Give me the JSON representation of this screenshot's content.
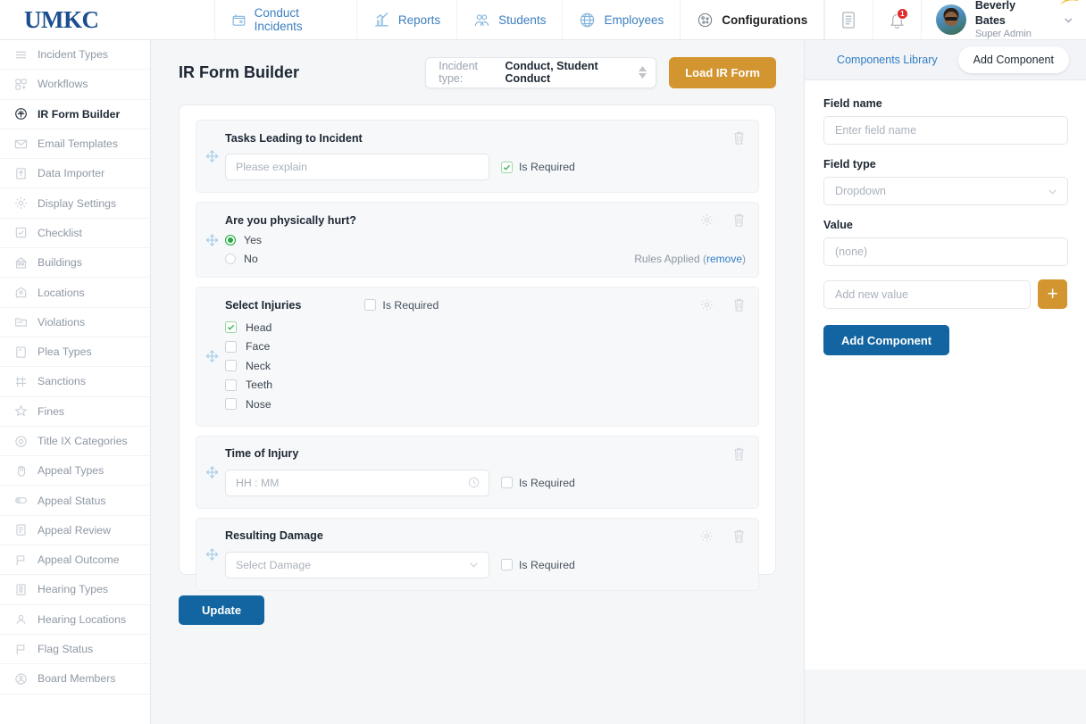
{
  "topbar": {
    "logo": "UMKC",
    "nav": [
      {
        "label": "Conduct Incidents",
        "icon": "incidents-icon",
        "active": false
      },
      {
        "label": "Reports",
        "icon": "reports-icon",
        "active": false
      },
      {
        "label": "Students",
        "icon": "students-icon",
        "active": false
      },
      {
        "label": "Employees",
        "icon": "employees-icon",
        "active": false
      },
      {
        "label": "Configurations",
        "icon": "configurations-icon",
        "active": true
      }
    ],
    "notifications_count": "1",
    "user_name": "Beverly Bates",
    "user_role": "Super Admin"
  },
  "sidebar": {
    "items": [
      {
        "label": "Incident Types",
        "icon": "list-icon"
      },
      {
        "label": "Workflows",
        "icon": "workflow-icon"
      },
      {
        "label": "IR Form Builder",
        "icon": "form-builder-icon"
      },
      {
        "label": "Email Templates",
        "icon": "envelope-icon"
      },
      {
        "label": "Data Importer",
        "icon": "upload-icon"
      },
      {
        "label": "Display Settings",
        "icon": "settings-gear-icon"
      },
      {
        "label": "Checklist",
        "icon": "checkbox-icon"
      },
      {
        "label": "Buildings",
        "icon": "building-icon"
      },
      {
        "label": "Locations",
        "icon": "location-icon"
      },
      {
        "label": "Violations",
        "icon": "folder-icon"
      },
      {
        "label": "Plea Types",
        "icon": "document-icon"
      },
      {
        "label": "Sanctions",
        "icon": "sanctions-icon"
      },
      {
        "label": "Fines",
        "icon": "fines-icon"
      },
      {
        "label": "Title IX Categories",
        "icon": "circle-target-icon"
      },
      {
        "label": "Appeal Types",
        "icon": "hand-icon"
      },
      {
        "label": "Appeal Status",
        "icon": "toggle-icon"
      },
      {
        "label": "Appeal Review",
        "icon": "review-doc-icon"
      },
      {
        "label": "Appeal Outcome",
        "icon": "flag-icon"
      },
      {
        "label": "Hearing Types",
        "icon": "hearing-doc-icon"
      },
      {
        "label": "Hearing Locations",
        "icon": "person-pin-icon"
      },
      {
        "label": "Flag Status",
        "icon": "flag-status-icon"
      },
      {
        "label": "Board Members",
        "icon": "board-member-icon"
      }
    ],
    "active_index": 2
  },
  "main": {
    "title": "IR Form Builder",
    "incident_type_label": "Incident type:",
    "incident_type_value": "Conduct, Student Conduct",
    "load_button": "Load IR Form",
    "update_button": "Update",
    "required_label": "Is Required",
    "rules_applied_text": "Rules Applied (",
    "rules_remove_link": "remove",
    "rules_applied_close": ")",
    "components": [
      {
        "title": "Tasks Leading to Incident",
        "kind": "text",
        "placeholder": "Please explain",
        "is_required": true,
        "has_gear": false,
        "has_rules": false
      },
      {
        "title": "Are you physically hurt?",
        "kind": "radio",
        "options": [
          {
            "label": "Yes",
            "selected": true
          },
          {
            "label": "No",
            "selected": false
          }
        ],
        "has_gear": true,
        "has_rules": true
      },
      {
        "title": "Select Injuries",
        "kind": "checkbox",
        "is_required": false,
        "options": [
          {
            "label": "Head",
            "checked": true
          },
          {
            "label": "Face",
            "checked": false
          },
          {
            "label": "Neck",
            "checked": false
          },
          {
            "label": "Teeth",
            "checked": false
          },
          {
            "label": "Nose",
            "checked": false
          }
        ],
        "has_gear": true,
        "has_rules": false
      },
      {
        "title": "Time of Injury",
        "kind": "time",
        "placeholder": "HH : MM",
        "is_required": false,
        "has_gear": false,
        "has_rules": false
      },
      {
        "title": "Resulting Damage",
        "kind": "dropdown",
        "placeholder": "Select Damage",
        "is_required": false,
        "has_gear": true,
        "has_rules": false
      }
    ]
  },
  "right_panel": {
    "tabs": [
      {
        "label": "Components Library",
        "active": false
      },
      {
        "label": "Add Component",
        "active": true
      }
    ],
    "field_name_label": "Field name",
    "field_name_placeholder": "Enter field name",
    "field_type_label": "Field type",
    "field_type_value": "Dropdown",
    "value_label": "Value",
    "value_current": "(none)",
    "add_value_placeholder": "Add new value",
    "add_value_button": "+",
    "add_component_button": "Add Component"
  },
  "colors": {
    "brand_blue": "#1c4e8f",
    "link_blue": "#2f7cc4",
    "primary_button": "#1265a0",
    "accent_orange": "#d2952f",
    "success_green": "#23ab3f",
    "badge_red": "#e02b2b"
  }
}
